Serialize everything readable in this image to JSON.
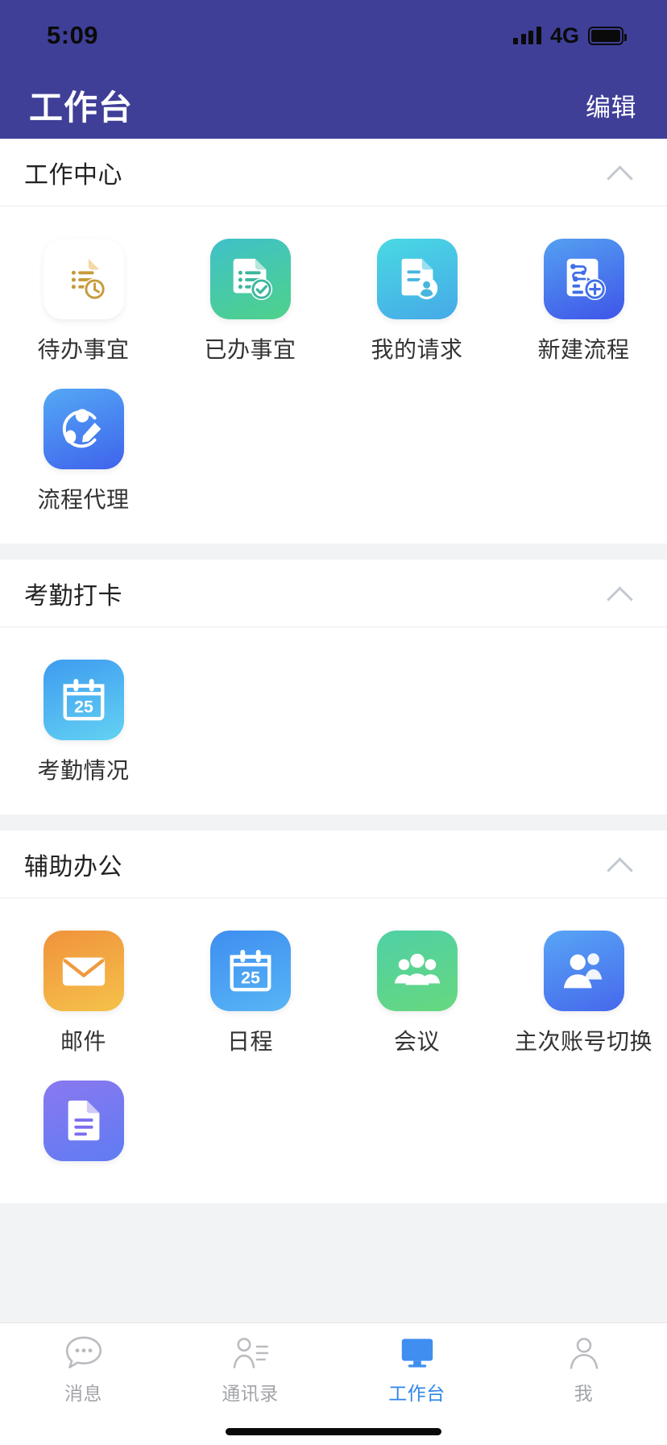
{
  "status_bar": {
    "time": "5:09",
    "network": "4G",
    "signal_icon": "signal-bars-icon",
    "battery_icon": "battery-full-icon"
  },
  "nav": {
    "title": "工作台",
    "action_label": "编辑"
  },
  "colors": {
    "header_bg": "#3f3f98",
    "page_bg": "#f2f3f5",
    "card_bg": "#ffffff",
    "label_text": "#333333",
    "section_title": "#222222",
    "chevron": "#c4c9d0",
    "tab_active": "#2f86e8",
    "tab_inactive": "#a2a4a8"
  },
  "sections": [
    {
      "title": "工作中心",
      "collapse_icon": "chevron-up-icon",
      "items": [
        {
          "label": "待办事宜",
          "icon": "document-clock-icon",
          "grad_from": "#ef8b3c",
          "grad_to": "#f5c councillors"
        },
        {
          "label": "已办事宜",
          "icon": "document-check-icon",
          "grad_from": "#3fc1c9",
          "grad_to": "#4fd18a"
        },
        {
          "label": "我的请求",
          "icon": "document-person-icon",
          "grad_from": "#49d9e3",
          "grad_to": "#46a9e8"
        },
        {
          "label": "新建流程",
          "icon": "flowchart-plus-icon",
          "grad_from": "#54a0f2",
          "grad_to": "#3f55e8"
        },
        {
          "label": "流程代理",
          "icon": "process-delegate-icon",
          "grad_from": "#54a8f5",
          "grad_to": "#3f63ec"
        }
      ]
    },
    {
      "title": "考勤打卡",
      "collapse_icon": "chevron-up-icon",
      "items": [
        {
          "label": "考勤情况",
          "icon": "calendar-25-icon",
          "grad_from": "#3e9bf0",
          "grad_to": "#63d2f2"
        }
      ]
    },
    {
      "title": "辅助办公",
      "collapse_icon": "chevron-up-icon",
      "items": [
        {
          "label": "邮件",
          "icon": "envelope-icon",
          "grad_from": "#f0923c",
          "grad_to": "#f5c24a"
        },
        {
          "label": "日程",
          "icon": "calendar-25-icon",
          "grad_from": "#3e8ef0",
          "grad_to": "#58b5f5"
        },
        {
          "label": "会议",
          "icon": "group-people-icon",
          "grad_from": "#4fd0a6",
          "grad_to": "#67d87e"
        },
        {
          "label": "主次账号切换",
          "icon": "account-switch-icon",
          "grad_from": "#58a5f5",
          "grad_to": "#4668ec"
        },
        {
          "label": "",
          "icon": "document-lines-icon",
          "grad_from": "#8a78f0",
          "grad_to": "#5f7cf2"
        }
      ]
    }
  ],
  "calendar_day": "25",
  "tabs": [
    {
      "label": "消息",
      "icon": "chat-bubble-icon",
      "active": false
    },
    {
      "label": "通讯录",
      "icon": "contacts-icon",
      "active": false
    },
    {
      "label": "工作台",
      "icon": "workbench-monitor-icon",
      "active": true
    },
    {
      "label": "我",
      "icon": "person-icon",
      "active": false
    }
  ]
}
